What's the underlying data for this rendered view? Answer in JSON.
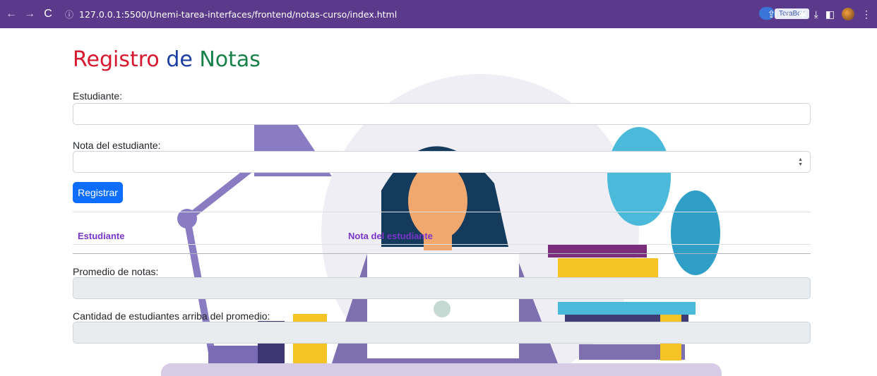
{
  "browser": {
    "url": "127.0.0.1:5500/Unemi-tarea-interfaces/frontend/notas-curso/index.html",
    "terabox_tooltip": "TeraBox"
  },
  "page": {
    "title_part1": "Registro",
    "title_part2": "de",
    "title_part3": "Notas",
    "student_label": "Estudiante:",
    "student_value": "",
    "grade_label": "Nota del estudiante:",
    "grade_value": "",
    "register_button": "Registrar",
    "table_headers": [
      "Estudiante",
      "Nota del estudiante"
    ],
    "average_label": "Promedio de notas:",
    "average_value": "",
    "above_avg_label": "Cantidad de estudiantes arriba del promedio:",
    "above_avg_value": ""
  },
  "colors": {
    "browser_bar": "#5b3a8c",
    "title_red": "#d6192f",
    "title_blue": "#1c3ea3",
    "title_green": "#188049",
    "primary_button": "#0d6efd",
    "table_header": "#7a35c9"
  }
}
